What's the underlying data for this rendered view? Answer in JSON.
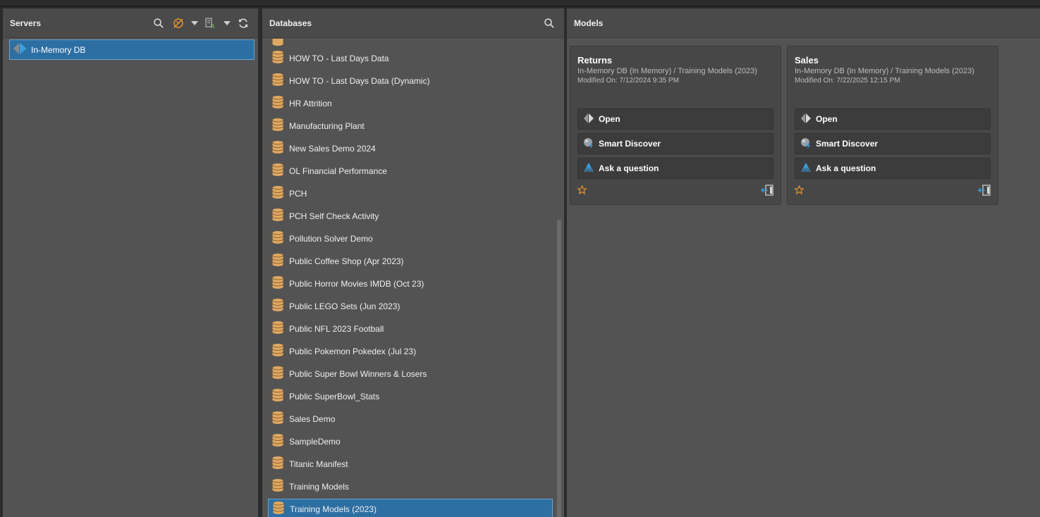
{
  "servers": {
    "title": "Servers",
    "items": [
      {
        "label": "In-Memory DB",
        "selected": true
      }
    ]
  },
  "databases": {
    "title": "Databases",
    "items": [
      "HOW TO - Last Days Data",
      "HOW TO - Last Days Data (Dynamic)",
      "HR Attrition",
      "Manufacturing Plant",
      "New Sales Demo 2024",
      "OL Financial Performance",
      "PCH",
      "PCH Self Check Activity",
      "Pollution Solver Demo",
      "Public Coffee Shop (Apr 2023)",
      "Public Horror Movies IMDB (Oct 23)",
      "Public LEGO Sets (Jun 2023)",
      "Public NFL 2023 Football",
      "Public Pokemon Pokedex (Jul 23)",
      "Public Super Bowl Winners & Losers",
      "Public SuperBowl_Stats",
      "Sales Demo",
      "SampleDemo",
      "Titanic Manifest",
      "Training Models",
      "Training Models (2023)"
    ],
    "selected": "Training Models (2023)"
  },
  "models": {
    "title": "Models",
    "cards": [
      {
        "title": "Returns",
        "path": "In-Memory DB (In Memory) / Training Models (2023)",
        "modified": "Modified On: 7/12/2024 9:35 PM",
        "actions": [
          "Open",
          "Smart Discover",
          "Ask a question"
        ]
      },
      {
        "title": "Sales",
        "path": "In-Memory DB (In Memory) / Training Models (2023)",
        "modified": "Modified On: 7/22/2025 12:15 PM",
        "actions": [
          "Open",
          "Smart Discover",
          "Ask a question"
        ]
      }
    ]
  },
  "colors": {
    "selection": "#2c6fa3",
    "db_icon": "#e0a860",
    "star": "#e89a2c",
    "accent_blue": "#3aa0e0"
  }
}
